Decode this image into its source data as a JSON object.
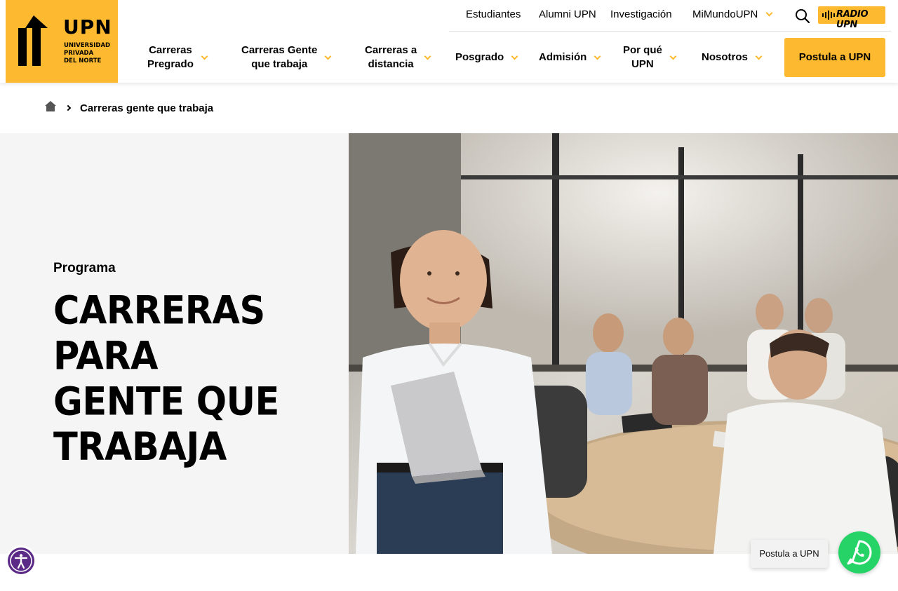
{
  "header": {
    "logo": {
      "brand": "UPN",
      "subtitle_lines": [
        "UNIVERSIDAD",
        "PRIVADA",
        "DEL NORTE"
      ]
    },
    "top_links": [
      "Estudiantes",
      "Alumni UPN",
      "Investigación",
      "MiMundoUPN"
    ],
    "radio_label": "RADIO UPN",
    "nav": [
      {
        "line1": "Carreras",
        "line2": "Pregrado"
      },
      {
        "line1": "Carreras Gente",
        "line2": "que trabaja"
      },
      {
        "line1": "Carreras a",
        "line2": "distancia"
      },
      {
        "line1": "Posgrado",
        "line2": ""
      },
      {
        "line1": "Admisión",
        "line2": ""
      },
      {
        "line1": "Por qué",
        "line2": "UPN"
      },
      {
        "line1": "Nosotros",
        "line2": ""
      }
    ],
    "cta_label": "Postula a UPN"
  },
  "breadcrumb": {
    "current": "Carreras gente que trabaja"
  },
  "hero": {
    "eyebrow": "Programa",
    "title_lines": [
      "CARRERAS PARA",
      "GENTE QUE",
      "TRABAJA"
    ]
  },
  "whatsapp": {
    "label": "Postula a UPN"
  },
  "colors": {
    "brand_yellow": "#FDBA30",
    "hero_bg": "#f5f5f5",
    "a11y_purple": "#5b2a86",
    "whatsapp_green": "#25D366"
  },
  "icons": [
    "search-icon",
    "home-icon",
    "chevron-down-icon",
    "chevron-right-icon",
    "accessibility-icon",
    "whatsapp-icon"
  ]
}
